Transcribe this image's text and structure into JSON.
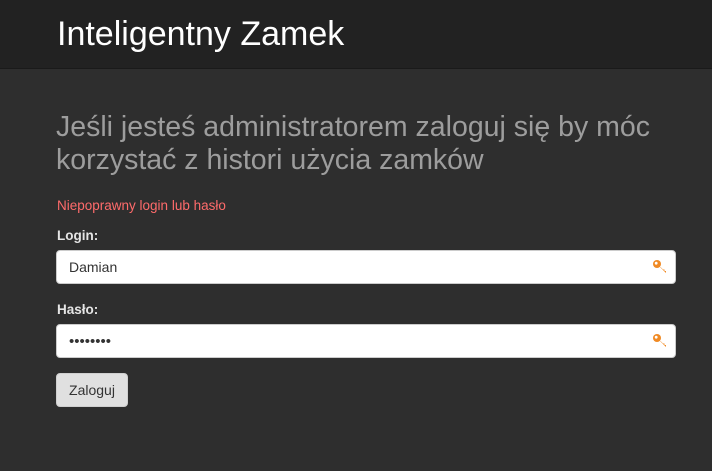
{
  "navbar": {
    "brand": "Inteligentny Zamek"
  },
  "main": {
    "heading": "Jeśli jesteś administratorem zaloguj się by móc korzystać z histori użycia zamków",
    "error": "Niepoprawny login lub hasło",
    "login": {
      "label": "Login:",
      "value": "Damian",
      "icon": "key-icon"
    },
    "password": {
      "label": "Hasło:",
      "value": "••••••••",
      "icon": "key-icon"
    },
    "submit_label": "Zaloguj"
  },
  "colors": {
    "navbar_bg": "#222222",
    "page_bg": "#2e2e2e",
    "heading": "#9d9d9d",
    "error": "#ff6b6b",
    "icon_accent": "#f08a24"
  }
}
